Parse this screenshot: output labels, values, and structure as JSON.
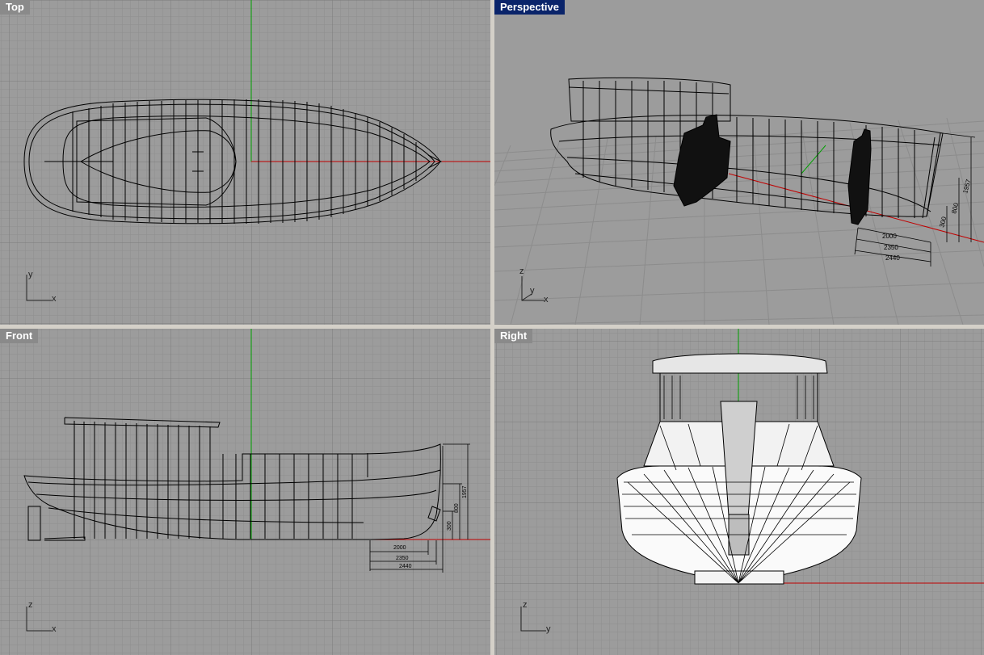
{
  "viewports": {
    "top": {
      "title": "Top",
      "active": false,
      "axes": [
        "y",
        "x"
      ]
    },
    "perspective": {
      "title": "Perspective",
      "active": true,
      "axes": [
        "z",
        "y",
        "x"
      ]
    },
    "front": {
      "title": "Front",
      "active": false,
      "axes": [
        "z",
        "x"
      ]
    },
    "right": {
      "title": "Right",
      "active": false,
      "axes": [
        "z",
        "y"
      ]
    }
  },
  "dimensions": {
    "front_horizontal": [
      "2000",
      "2350",
      "2440"
    ],
    "front_vertical": [
      "1957",
      "800",
      "300"
    ],
    "perspective_horizontal": [
      "2000",
      "2350",
      "2440"
    ],
    "perspective_vertical": [
      "1957",
      "800",
      "300"
    ]
  },
  "colors": {
    "viewport_bg": "#9c9c9c",
    "grid_minor": "#8e8e8e",
    "grid_major": "#7c7c7c",
    "x_axis": "#c00000",
    "y_axis": "#00a000",
    "wire": "#000000",
    "active_title_bg": "#0a246a",
    "inactive_title_bg": "#8a8a8a"
  }
}
